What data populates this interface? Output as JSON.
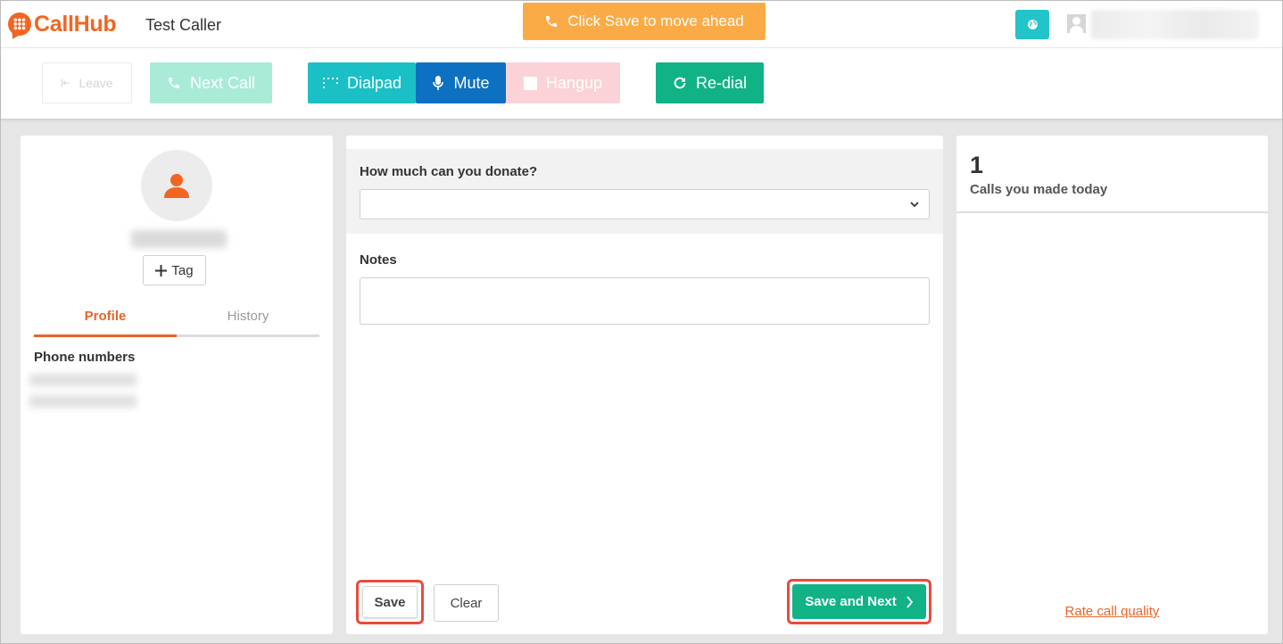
{
  "header": {
    "logo_text": "CallHub",
    "caller_name": "Test Caller",
    "notice": "Click Save to move ahead",
    "notice_color": "#fbab46"
  },
  "toolbar": {
    "leave_label": "Leave",
    "next_call_label": "Next Call",
    "dialpad_label": "Dialpad",
    "mute_label": "Mute",
    "hangup_label": "Hangup",
    "redial_label": "Re-dial"
  },
  "contact": {
    "add_tag_label": "Tag",
    "tabs": [
      {
        "label": "Profile",
        "active": true
      },
      {
        "label": "History",
        "active": false
      }
    ],
    "phone_numbers_label": "Phone numbers"
  },
  "script": {
    "question_label": "How much can you donate?",
    "question_value": "",
    "notes_label": "Notes",
    "notes_value": "",
    "save_label": "Save",
    "clear_label": "Clear",
    "save_next_label": "Save and Next"
  },
  "stats": {
    "calls_count": "1",
    "calls_label": "Calls you made today",
    "rate_link": "Rate call quality"
  },
  "colors": {
    "brand_orange": "#f26522",
    "teal": "#1ac0c6",
    "blue": "#0e70c0",
    "green": "#11b386",
    "highlight_red": "#e84b3c"
  }
}
